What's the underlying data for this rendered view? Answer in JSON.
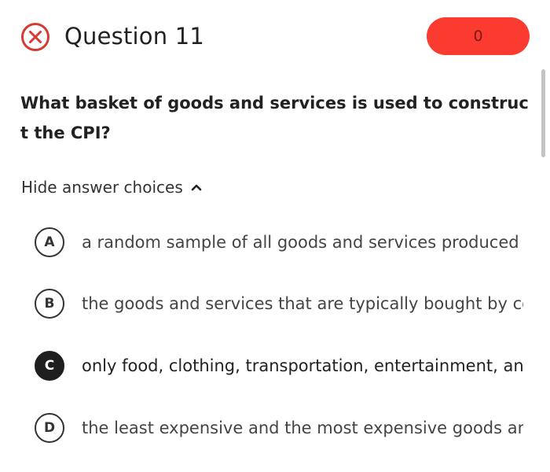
{
  "header": {
    "status_icon": "x-circle-icon",
    "title": "Question 11",
    "score": "0"
  },
  "question": {
    "text": "What basket of goods and services is used to construct the CPI?"
  },
  "toggle": {
    "label": "Hide answer choices",
    "icon": "chevron-up-icon"
  },
  "choices": [
    {
      "letter": "A",
      "text": "a random sample of all goods and services produced",
      "selected": false
    },
    {
      "letter": "B",
      "text": "the goods and services that are typically bought by consumers",
      "selected": false
    },
    {
      "letter": "C",
      "text": "only food, clothing, transportation, entertainment, and",
      "selected": true
    },
    {
      "letter": "D",
      "text": "the least expensive and the most expensive goods and",
      "selected": false
    }
  ],
  "colors": {
    "incorrect_red": "#d43b33",
    "score_pill": "#fb3b2f",
    "selected_badge": "#1f1f1f"
  }
}
